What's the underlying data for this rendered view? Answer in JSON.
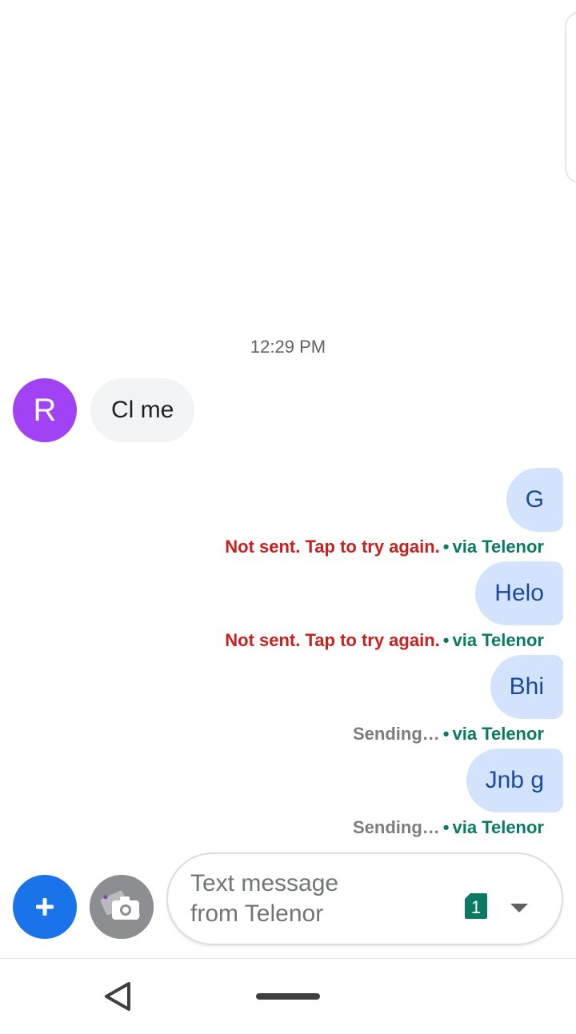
{
  "conversation": {
    "timestamp": "12:29 PM",
    "contact_initial": "R",
    "incoming_message": "Cl me"
  },
  "outgoing": [
    {
      "text": "G",
      "status": "Not sent. Tap to try again.",
      "status_type": "error",
      "carrier": "via Telenor"
    },
    {
      "text": "Helo",
      "status": "Not sent. Tap to try again.",
      "status_type": "error",
      "carrier": "via Telenor"
    },
    {
      "text": "Bhi",
      "status": "Sending…",
      "status_type": "pending",
      "carrier": "via Telenor"
    },
    {
      "text": "Jnb g",
      "status": "Sending…",
      "status_type": "pending",
      "carrier": "via Telenor"
    }
  ],
  "separator": "•",
  "composer": {
    "placeholder": "Text message\nfrom Telenor",
    "sim_number": "1"
  },
  "icons": {
    "add": "plus-icon",
    "gallery": "camera-icon",
    "sim": "sim-card-icon",
    "dropdown": "arrow-drop-down-icon",
    "back": "back-triangle-icon",
    "home": "home-pill"
  },
  "colors": {
    "avatar": "#a142f4",
    "outgoing_bubble": "#d3e3fd",
    "outgoing_text": "#1a4a9c",
    "error_text": "#c5221f",
    "carrier_text": "#0b7a64",
    "fab": "#1a73e8"
  }
}
